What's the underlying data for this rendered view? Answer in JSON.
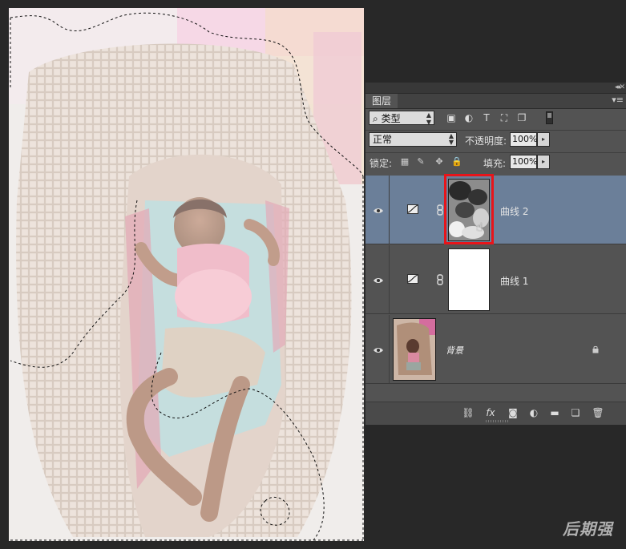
{
  "panel": {
    "tab_label": "图层",
    "filter": {
      "selected": "类型"
    },
    "blend_mode": "正常",
    "opacity_label": "不透明度:",
    "opacity_value": "100%",
    "lock_label": "锁定:",
    "fill_label": "填充:",
    "fill_value": "100%",
    "layers": [
      {
        "name": "曲线 2",
        "type": "curves-adjustment",
        "selected": true,
        "mask": "painted",
        "highlighted": true
      },
      {
        "name": "曲线 1",
        "type": "curves-adjustment",
        "selected": false,
        "mask": "white"
      },
      {
        "name": "背景",
        "type": "background",
        "locked": true
      }
    ],
    "bottom_icons": [
      "link-icon",
      "fx-icon",
      "mask-icon",
      "adjustment-icon",
      "group-folder-icon",
      "new-layer-icon",
      "trash-icon"
    ],
    "fx_label": "fx"
  },
  "colors": {
    "panel_bg": "#535353",
    "selected_row": "#6b7f99",
    "highlight_box": "#e8141a"
  },
  "watermark": "后期强"
}
